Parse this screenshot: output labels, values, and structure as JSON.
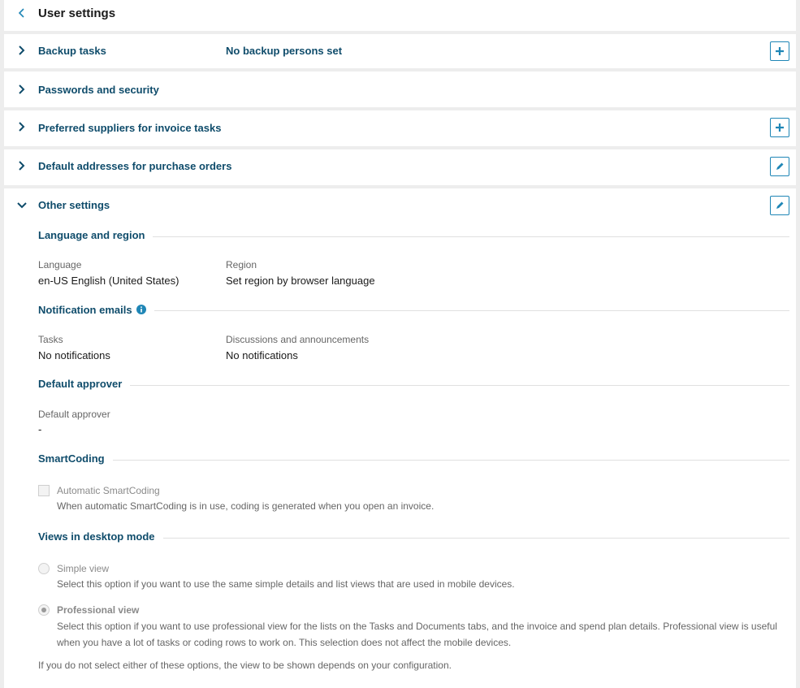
{
  "header": {
    "title": "User settings"
  },
  "sections": {
    "backup": {
      "title": "Backup tasks",
      "value": "No backup persons set"
    },
    "passwords": {
      "title": "Passwords and security"
    },
    "suppliers": {
      "title": "Preferred suppliers for invoice tasks"
    },
    "addresses": {
      "title": "Default addresses for purchase orders"
    },
    "other": {
      "title": "Other settings"
    }
  },
  "other": {
    "language_region": {
      "title": "Language and region",
      "language_label": "Language",
      "language_value": "en-US English (United States)",
      "region_label": "Region",
      "region_value": "Set region by browser language"
    },
    "notifications": {
      "title": "Notification emails",
      "tasks_label": "Tasks",
      "tasks_value": "No notifications",
      "discussions_label": "Discussions and announcements",
      "discussions_value": "No notifications"
    },
    "approver": {
      "title": "Default approver",
      "label": "Default approver",
      "value": "-"
    },
    "smartcoding": {
      "title": "SmartCoding",
      "checkbox_label": "Automatic SmartCoding",
      "description": "When automatic SmartCoding is in use, coding is generated when you open an invoice."
    },
    "views": {
      "title": "Views in desktop mode",
      "simple_label": "Simple view",
      "simple_desc": "Select this option if you want to use the same simple details and list views that are used in mobile devices.",
      "professional_label": "Professional view",
      "professional_desc_1": "Select this option if you want to use professional view for the lists on the Tasks and Documents tabs, and the invoice and spend plan details. Professional view is useful",
      "professional_desc_2": "when you have a lot of tasks or coding rows to work on. This selection does not affect the mobile devices.",
      "footer_note": "If you do not select either of these options, the view to be shown depends on your configuration."
    }
  },
  "colors": {
    "accent": "#1f86b6",
    "heading": "#0f4c6b",
    "background": "#ededed"
  }
}
